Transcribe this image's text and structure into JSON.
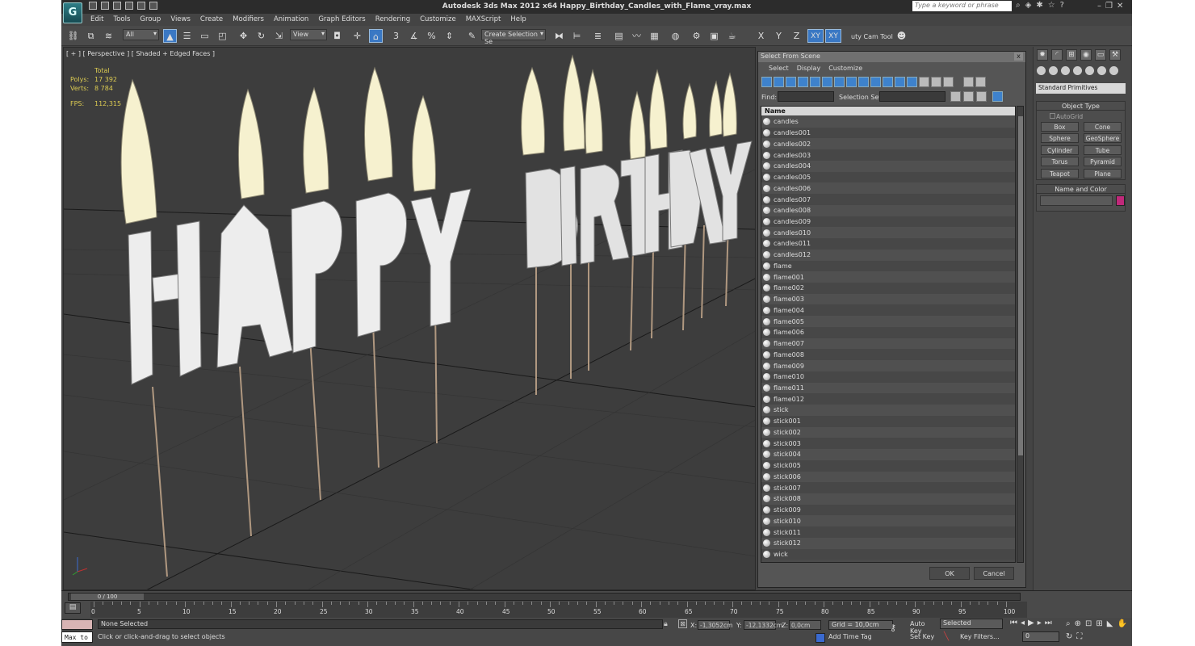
{
  "window": {
    "title": "Autodesk 3ds Max  2012 x64      Happy_Birthday_Candles_with_Flame_vray.max",
    "search_placeholder": "Type a keyword or phrase",
    "logo": "G"
  },
  "menu": [
    "Edit",
    "Tools",
    "Group",
    "Views",
    "Create",
    "Modifiers",
    "Animation",
    "Graph Editors",
    "Rendering",
    "Customize",
    "MAXScript",
    "Help"
  ],
  "toolbar": {
    "filter": "All",
    "ref_coord": "View",
    "selection_set": "Create Selection Se",
    "constraint_labels": [
      "X",
      "Y",
      "Z",
      "XY",
      "XY"
    ],
    "camera_tool": "uty Cam Tool"
  },
  "viewport": {
    "label": "[ + ] [ Perspective ] [ Shaded + Edged Faces ]",
    "stats": {
      "total_label": "Total",
      "polys_label": "Polys:",
      "polys": "17 392",
      "verts_label": "Verts:",
      "verts": "8 784",
      "fps_label": "FPS:",
      "fps": "112,315"
    }
  },
  "scene_dialog": {
    "title": "Select From Scene",
    "close": "x",
    "menus": [
      "Select",
      "Display",
      "Customize"
    ],
    "find_label": "Find:",
    "selection_set_label": "Selection Set:",
    "column_header": "Name",
    "items": [
      "candles",
      "candles001",
      "candles002",
      "candles003",
      "candles004",
      "candles005",
      "candles006",
      "candles007",
      "candles008",
      "candles009",
      "candles010",
      "candles011",
      "candles012",
      "flame",
      "flame001",
      "flame002",
      "flame003",
      "flame004",
      "flame005",
      "flame006",
      "flame007",
      "flame008",
      "flame009",
      "flame010",
      "flame011",
      "flame012",
      "stick",
      "stick001",
      "stick002",
      "stick003",
      "stick004",
      "stick005",
      "stick006",
      "stick007",
      "stick008",
      "stick009",
      "stick010",
      "stick011",
      "stick012",
      "wick"
    ],
    "ok": "OK",
    "cancel": "Cancel"
  },
  "command_panel": {
    "category": "Standard Primitives",
    "object_type_title": "Object Type",
    "autogrid": "AutoGrid",
    "buttons": [
      "Box",
      "Cone",
      "Sphere",
      "GeoSphere",
      "Cylinder",
      "Tube",
      "Torus",
      "Pyramid",
      "Teapot",
      "Plane"
    ],
    "name_color_title": "Name and Color",
    "color": "#c0297a"
  },
  "timeline": {
    "slider": "0 / 100",
    "ticks": [
      "0",
      "5",
      "10",
      "15",
      "20",
      "25",
      "30",
      "35",
      "40",
      "45",
      "50",
      "55",
      "60",
      "65",
      "70",
      "75",
      "80",
      "85",
      "90",
      "95",
      "100"
    ]
  },
  "status": {
    "maxscript": "Max to",
    "selection": "None Selected",
    "prompt": "Click or click-and-drag to select objects",
    "x_label": "X:",
    "x": "-1,3052cm",
    "y_label": "Y:",
    "y": "-12,1332cm",
    "z_label": "Z:",
    "z": "0,0cm",
    "grid": "Grid = 10,0cm",
    "add_time_tag": "Add Time Tag",
    "auto_key": "Auto Key",
    "set_key": "Set Key",
    "key_mode": "Selected",
    "key_filters": "Key Filters...",
    "frame": "0"
  }
}
